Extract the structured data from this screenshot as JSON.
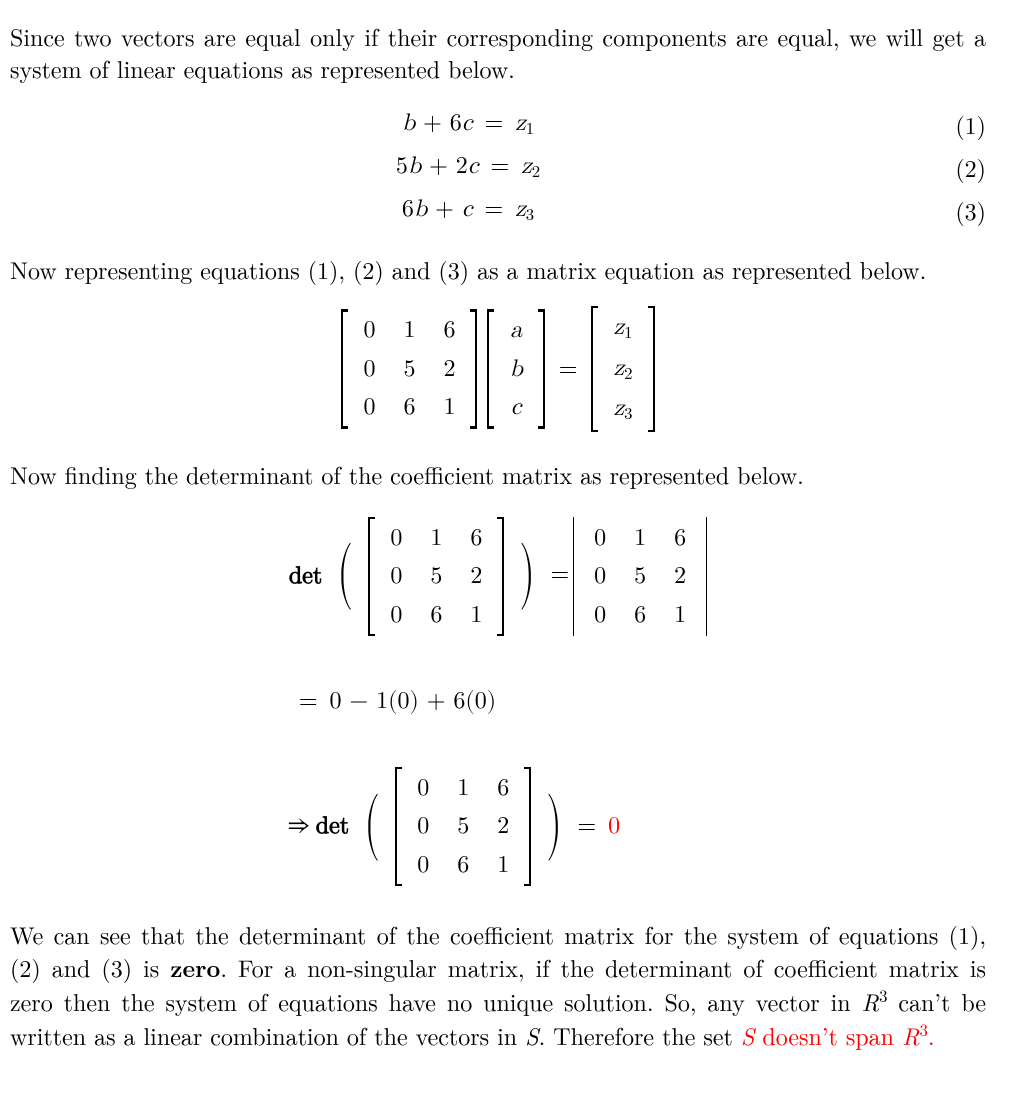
{
  "para1": "Since two vectors are equal only if their corresponding components are equal, we will get a system of linear equations as represented below.",
  "eqns": {
    "rows": [
      {
        "lhs_html": "<span class='mi'>b</span> + 6<span class='mi'>c</span>",
        "rhs_html": "<span class='mi'>z</span><span class='sub'>1</span>",
        "num": "(1)"
      },
      {
        "lhs_html": "5<span class='mi'>b</span> + 2<span class='mi'>c</span>",
        "rhs_html": "<span class='mi'>z</span><span class='sub'>2</span>",
        "num": "(2)"
      },
      {
        "lhs_html": "6<span class='mi'>b</span> + <span class='mi'>c</span>",
        "rhs_html": "<span class='mi'>z</span><span class='sub'>3</span>",
        "num": "(3)"
      }
    ]
  },
  "para2": "Now representing equations (1), (2) and (3) as a matrix equation as represented below.",
  "matrixA": [
    [
      "0",
      "1",
      "6"
    ],
    [
      "0",
      "5",
      "2"
    ],
    [
      "0",
      "6",
      "1"
    ]
  ],
  "vec_x": [
    "a",
    "b",
    "c"
  ],
  "vec_z": [
    "z1",
    "z2",
    "z3"
  ],
  "para3": "Now finding the determinant of the coefficient matrix as represented below.",
  "det": {
    "label": "det",
    "expand": "0 − 1(0) + 6(0)",
    "result": "0",
    "arrow": "⇒"
  },
  "para4_a": "We can see that the determinant of the coefficient matrix for the system of equations (1), (2) and (3) is ",
  "para4_bold": "zero",
  "para4_b": ". For a non-singular matrix, if the determinant of coefficient matrix is zero then the system of equations have no unique solution. So, any vector in ",
  "R3_html": "<span class='mi'>R</span><span class='sup'>3</span>",
  "para4_c": " can’t be written as a linear combination of the vectors in ",
  "S_html": "<span class='mi'>S</span>",
  "para4_d": ". Therefore the set ",
  "final_red_html": "<span class='mi'>S</span> doesn’t span <span class='mi'>R</span><span class='sup'>3</span>",
  "chart_data": {
    "type": "table",
    "coefficient_matrix": [
      [
        0,
        1,
        6
      ],
      [
        0,
        5,
        2
      ],
      [
        0,
        6,
        1
      ]
    ],
    "unknowns": [
      "a",
      "b",
      "c"
    ],
    "rhs": [
      "z1",
      "z2",
      "z3"
    ],
    "determinant": 0,
    "determinant_expansion": "0 - 1*(0) + 6*(0)"
  }
}
